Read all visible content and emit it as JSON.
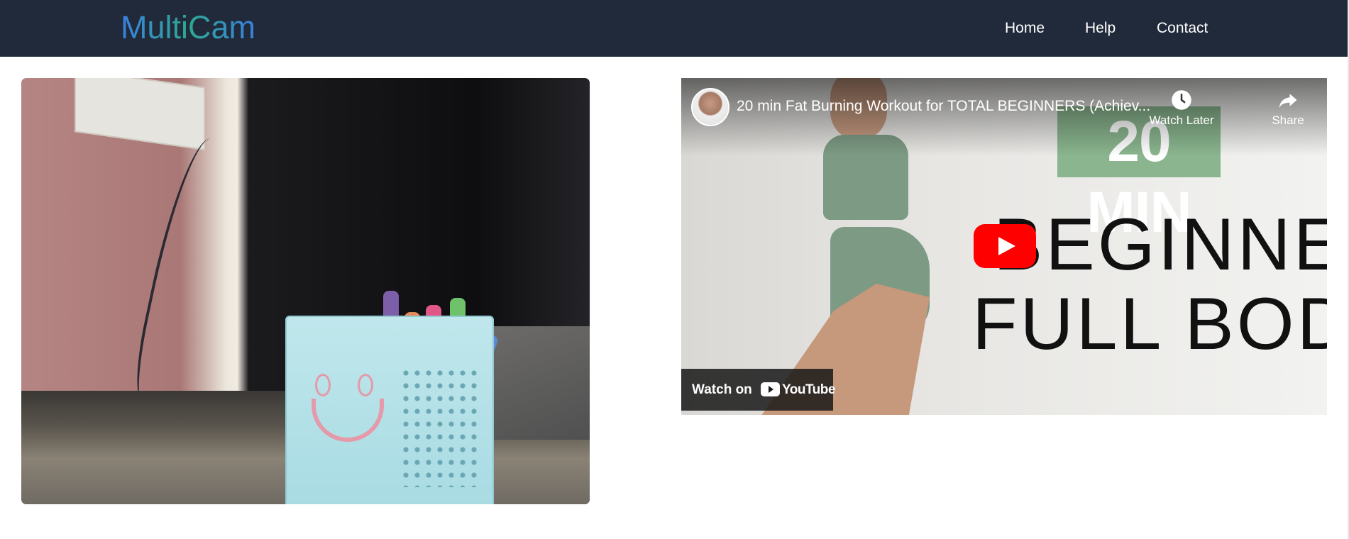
{
  "navbar": {
    "brand": "MultiCam",
    "links": [
      {
        "label": "Home"
      },
      {
        "label": "Help"
      },
      {
        "label": "Contact"
      }
    ]
  },
  "video": {
    "title": "20 min Fat Burning Workout for TOTAL BEGINNERS (Achiev...",
    "watch_later": "Watch Later",
    "share": "Share",
    "thumbnail_badge": "20 MIN",
    "thumbnail_line1": "BEGINNER",
    "thumbnail_line2": "FULL BODY",
    "watch_on": "Watch on",
    "youtube": "YouTube"
  },
  "colors": {
    "navbar_bg": "#212a3a",
    "brand_gradient": [
      "#3a7fe0",
      "#2ea890"
    ],
    "youtube_red": "#ff0000"
  }
}
